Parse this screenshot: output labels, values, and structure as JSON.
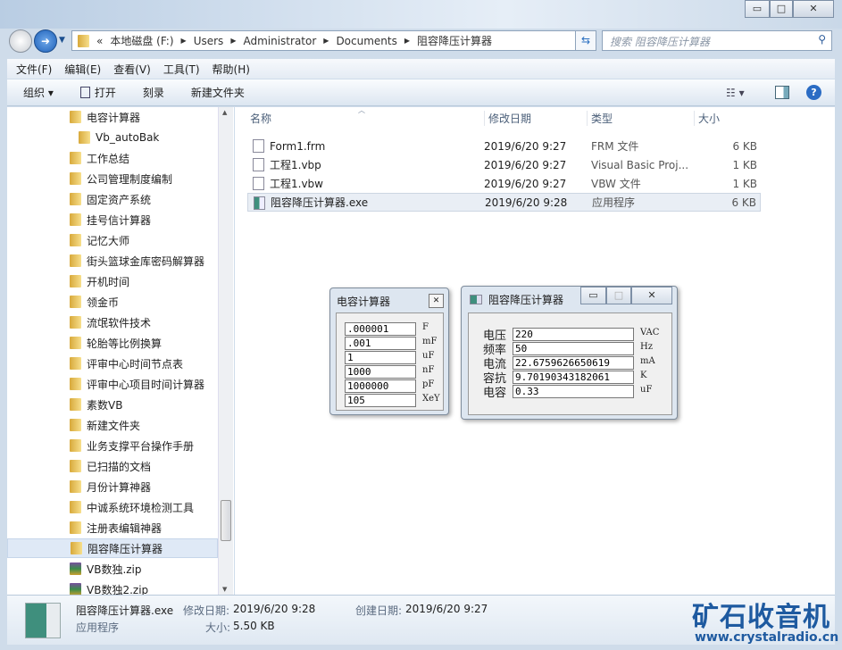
{
  "window": {
    "min": "▭",
    "max": "□",
    "close": "✕"
  },
  "address": {
    "overflow": "«",
    "crumbs": [
      "本地磁盘 (F:)",
      "Users",
      "Administrator",
      "Documents",
      "阻容降压计算器"
    ],
    "search_placeholder": "搜索 阻容降压计算器"
  },
  "menu": [
    "文件(F)",
    "编辑(E)",
    "查看(V)",
    "工具(T)",
    "帮助(H)"
  ],
  "toolbar": {
    "organize": "组织 ▾",
    "open": "打开",
    "burn": "刻录",
    "new_folder": "新建文件夹"
  },
  "nav": [
    {
      "label": "电容计算器",
      "indent": 0
    },
    {
      "label": "Vb_autoBak",
      "indent": 1
    },
    {
      "label": "工作总结",
      "indent": 0
    },
    {
      "label": "公司管理制度编制",
      "indent": 0
    },
    {
      "label": "固定资产系统",
      "indent": 0
    },
    {
      "label": "挂号信计算器",
      "indent": 0
    },
    {
      "label": "记忆大师",
      "indent": 0
    },
    {
      "label": "街头篮球金库密码解算器",
      "indent": 0
    },
    {
      "label": "开机时间",
      "indent": 0
    },
    {
      "label": "领金币",
      "indent": 0
    },
    {
      "label": "流氓软件技术",
      "indent": 0
    },
    {
      "label": "轮胎等比例换算",
      "indent": 0
    },
    {
      "label": "评审中心时间节点表",
      "indent": 0
    },
    {
      "label": "评审中心项目时间计算器",
      "indent": 0
    },
    {
      "label": "素数VB",
      "indent": 0
    },
    {
      "label": "新建文件夹",
      "indent": 0
    },
    {
      "label": "业务支撑平台操作手册",
      "indent": 0
    },
    {
      "label": "已扫描的文档",
      "indent": 0
    },
    {
      "label": "月份计算神器",
      "indent": 0
    },
    {
      "label": "中诚系统环境检测工具",
      "indent": 0
    },
    {
      "label": "注册表编辑神器",
      "indent": 0
    },
    {
      "label": "阻容降压计算器",
      "indent": 0,
      "selected": true
    },
    {
      "label": "VB数独.zip",
      "indent": 0,
      "zip": true
    },
    {
      "label": "VB数独2.zip",
      "indent": 0,
      "zip": true
    }
  ],
  "columns": [
    "名称",
    "修改日期",
    "类型",
    "大小"
  ],
  "files": [
    {
      "name": "Form1.frm",
      "date": "2019/6/20 9:27",
      "type": "FRM 文件",
      "size": "6 KB"
    },
    {
      "name": "工程1.vbp",
      "date": "2019/6/20 9:27",
      "type": "Visual Basic Proj...",
      "size": "1 KB"
    },
    {
      "name": "工程1.vbw",
      "date": "2019/6/20 9:27",
      "type": "VBW 文件",
      "size": "1 KB"
    },
    {
      "name": "阻容降压计算器.exe",
      "date": "2019/6/20 9:28",
      "type": "应用程序",
      "size": "6 KB",
      "selected": true
    }
  ],
  "status": {
    "name": "阻容降压计算器.exe",
    "modified_label": "修改日期:",
    "modified": "2019/6/20 9:28",
    "created_label": "创建日期:",
    "created": "2019/6/20 9:27",
    "type": "应用程序",
    "size_label": "大小:",
    "size": "5.50 KB"
  },
  "watermark": {
    "title": "矿石收音机",
    "url": "www.crystalradio.cn"
  },
  "cap_dialog": {
    "title": "电容计算器",
    "close": "✕",
    "fields": [
      {
        "value": ".000001",
        "unit": "F"
      },
      {
        "value": ".001",
        "unit": "mF"
      },
      {
        "value": "1",
        "unit": "uF"
      },
      {
        "value": "1000",
        "unit": "nF"
      },
      {
        "value": "1000000",
        "unit": "pF"
      },
      {
        "value": "105",
        "unit": "XeY"
      }
    ]
  },
  "rc_dialog": {
    "title": "阻容降压计算器",
    "fields": [
      {
        "label": "电压",
        "value": "220",
        "unit": "VAC"
      },
      {
        "label": "频率",
        "value": "50",
        "unit": "Hz"
      },
      {
        "label": "电流",
        "value": "22.6759626650619",
        "unit": "mA"
      },
      {
        "label": "容抗",
        "value": "9.70190343182061",
        "unit": "K"
      },
      {
        "label": "电容",
        "value": "0.33",
        "unit": "uF"
      }
    ]
  }
}
